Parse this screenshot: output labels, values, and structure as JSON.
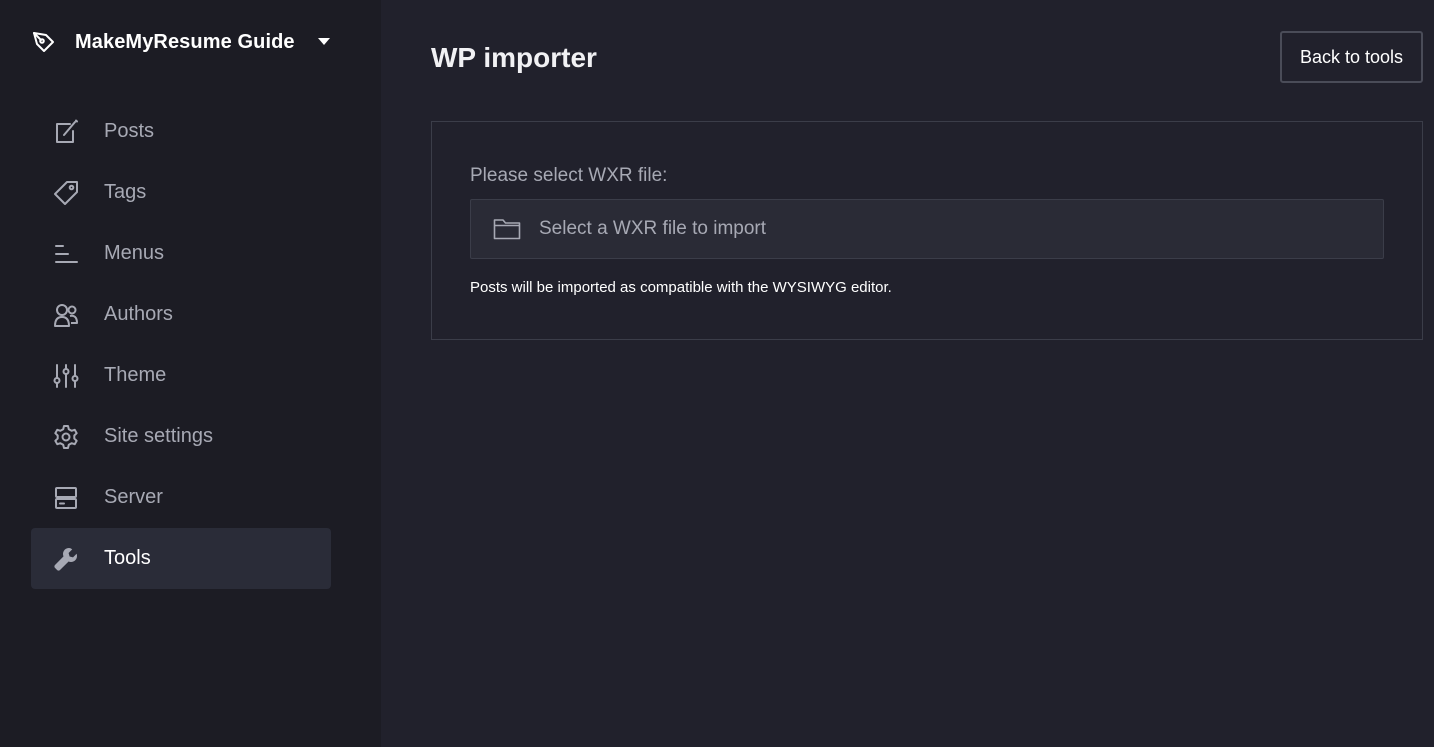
{
  "site": {
    "name": "MakeMyResume Guide"
  },
  "sidebar": {
    "items": [
      {
        "label": "Posts",
        "icon": "edit-icon"
      },
      {
        "label": "Tags",
        "icon": "tag-icon"
      },
      {
        "label": "Menus",
        "icon": "menu-icon"
      },
      {
        "label": "Authors",
        "icon": "users-icon"
      },
      {
        "label": "Theme",
        "icon": "sliders-icon"
      },
      {
        "label": "Site settings",
        "icon": "gear-icon"
      },
      {
        "label": "Server",
        "icon": "server-icon"
      },
      {
        "label": "Tools",
        "icon": "wrench-icon",
        "active": true
      }
    ]
  },
  "main": {
    "title": "WP importer",
    "back_label": "Back to tools",
    "file_label": "Please select WXR file:",
    "file_placeholder": "Select a WXR file to import",
    "hint": "Posts will be imported as compatible with the WYSIWYG editor."
  },
  "colors": {
    "sidebar_bg": "#1c1c24",
    "main_bg": "#21212c",
    "active_item_bg": "#2a2c38",
    "muted_text": "#a7a9b4"
  }
}
